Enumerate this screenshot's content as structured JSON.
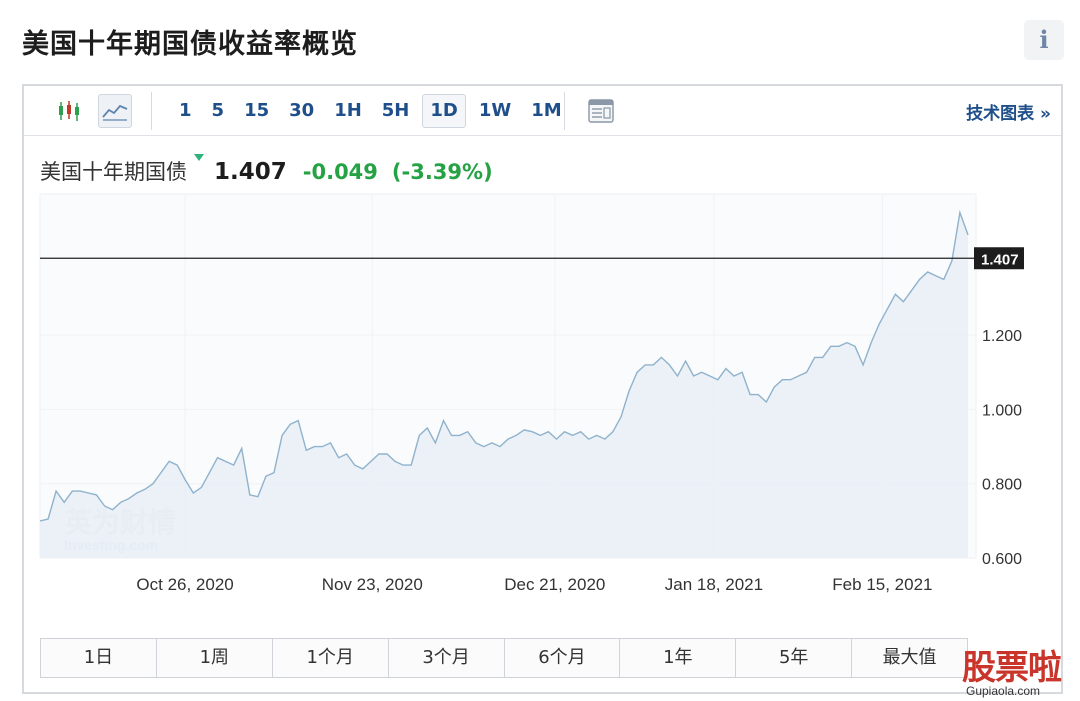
{
  "page": {
    "title": "美国十年期国债收益率概览",
    "info_icon": "i"
  },
  "toolbar": {
    "intervals": [
      "1",
      "5",
      "15",
      "30",
      "1H",
      "5H",
      "1D",
      "1W",
      "1M"
    ],
    "active_interval": "1D",
    "tech_link": "技术图表 »",
    "icons": [
      "candlestick-icon",
      "line-chart-icon",
      "table-icon"
    ]
  },
  "quote": {
    "name": "美国十年期国债",
    "price": "1.407",
    "change": "-0.049",
    "change_pct": "(-3.39%)",
    "colors": {
      "down": "#25a244",
      "flag": "#2db37a"
    }
  },
  "chart_data": {
    "type": "area",
    "x_ticks": [
      "Oct 26, 2020",
      "Nov 23, 2020",
      "Dec 21, 2020",
      "Jan 18, 2021",
      "Feb 15, 2021"
    ],
    "y_ticks": [
      "1.200",
      "1.000",
      "0.800",
      "0.600"
    ],
    "ylim": [
      0.6,
      1.58
    ],
    "current_value_label": "1.407",
    "current_value": 1.407,
    "grid": true,
    "color": "#8fb2cc",
    "fill": "#e9f0f6",
    "series": [
      {
        "values": [
          0.7,
          0.705,
          0.78,
          0.75,
          0.78,
          0.78,
          0.775,
          0.77,
          0.74,
          0.73,
          0.75,
          0.76,
          0.775,
          0.785,
          0.8,
          0.83,
          0.86,
          0.85,
          0.81,
          0.775,
          0.79,
          0.83,
          0.87,
          0.86,
          0.85,
          0.895,
          0.77,
          0.765,
          0.82,
          0.83,
          0.93,
          0.96,
          0.97,
          0.89,
          0.9,
          0.9,
          0.91,
          0.87,
          0.88,
          0.85,
          0.84,
          0.86,
          0.88,
          0.88,
          0.86,
          0.85,
          0.85,
          0.93,
          0.95,
          0.91,
          0.97,
          0.93,
          0.93,
          0.94,
          0.91,
          0.9,
          0.91,
          0.9,
          0.92,
          0.93,
          0.945,
          0.94,
          0.93,
          0.94,
          0.92,
          0.94,
          0.93,
          0.94,
          0.92,
          0.93,
          0.92,
          0.94,
          0.98,
          1.05,
          1.1,
          1.12,
          1.12,
          1.14,
          1.12,
          1.09,
          1.13,
          1.09,
          1.1,
          1.09,
          1.08,
          1.11,
          1.09,
          1.1,
          1.04,
          1.04,
          1.02,
          1.06,
          1.08,
          1.08,
          1.09,
          1.1,
          1.14,
          1.14,
          1.17,
          1.17,
          1.18,
          1.17,
          1.12,
          1.18,
          1.23,
          1.27,
          1.31,
          1.29,
          1.32,
          1.35,
          1.37,
          1.36,
          1.35,
          1.4,
          1.53,
          1.47
        ]
      }
    ]
  },
  "watermarks": {
    "chart": [
      "英为财情",
      "Investing.com"
    ],
    "site_title": "股票啦",
    "site_url": "Gupiaola.com"
  },
  "periods": [
    "1日",
    "1周",
    "1个月",
    "3个月",
    "6个月",
    "1年",
    "5年",
    "最大值"
  ]
}
